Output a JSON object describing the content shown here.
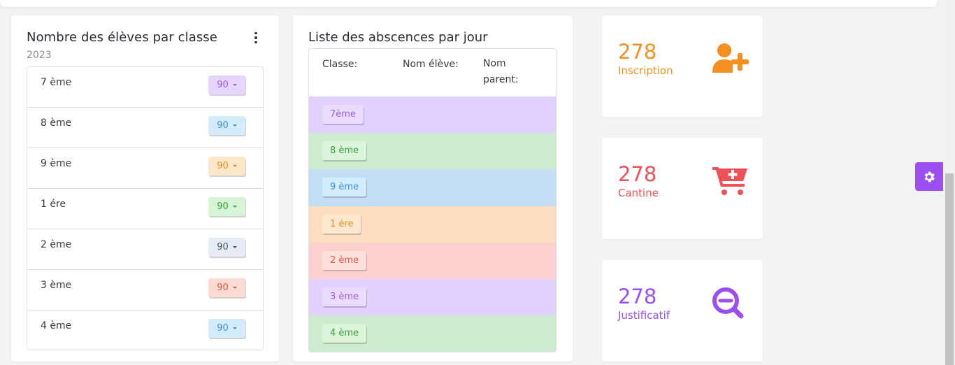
{
  "classes_card": {
    "title": "Nombre des élèves par classe",
    "year": "2023",
    "rows": [
      {
        "label": "7 ème",
        "count": "90",
        "bg": "#e6d6ff",
        "fg": "#9b5de5"
      },
      {
        "label": "8 ème",
        "count": "90",
        "bg": "#d2ecfb",
        "fg": "#3b8fd9"
      },
      {
        "label": "9 ème",
        "count": "90",
        "bg": "#fde7c9",
        "fg": "#e8891a"
      },
      {
        "label": "1 ére",
        "count": "90",
        "bg": "#d6f5d6",
        "fg": "#3aa13a"
      },
      {
        "label": "2 ème",
        "count": "90",
        "bg": "#e6ebf5",
        "fg": "#4a5670"
      },
      {
        "label": "3 ème",
        "count": "90",
        "bg": "#fddbd3",
        "fg": "#e05a46"
      },
      {
        "label": "4 ème",
        "count": "90",
        "bg": "#d2ecfb",
        "fg": "#3b8fd9"
      }
    ]
  },
  "absences_card": {
    "title": "Liste des abscences par jour",
    "headers": {
      "classe": "Classe:",
      "nom_eleve": "Nom élève:",
      "nom_parent": "Nom parent:"
    },
    "rows": [
      {
        "tag": "7ème",
        "row_bg": "#e1d1ff",
        "tag_bg": "#eadcff",
        "tag_fg": "#9b5de5"
      },
      {
        "tag": "8 ème",
        "row_bg": "#ccebcf",
        "tag_bg": "#dcf3dc",
        "tag_fg": "#3aa13a"
      },
      {
        "tag": "9 ème",
        "row_bg": "#c4def5",
        "tag_bg": "#d2ecfb",
        "tag_fg": "#3b8fd9"
      },
      {
        "tag": "1 ére",
        "row_bg": "#fddcbf",
        "tag_bg": "#fde9cf",
        "tag_fg": "#e8891a"
      },
      {
        "tag": "2 ème",
        "row_bg": "#fcd0cf",
        "tag_bg": "#fde0db",
        "tag_fg": "#e05a46"
      },
      {
        "tag": "3 ème",
        "row_bg": "#e1d1ff",
        "tag_bg": "#eadcff",
        "tag_fg": "#9b5de5"
      },
      {
        "tag": "4 ème",
        "row_bg": "#ccebcf",
        "tag_bg": "#dcf3dc",
        "tag_fg": "#3aa13a"
      }
    ]
  },
  "stats": [
    {
      "value": "278",
      "label": "Inscription",
      "color": "#f39021",
      "icon": "user-plus-icon"
    },
    {
      "value": "278",
      "label": "Cantine",
      "color": "#f05156",
      "icon": "cart-plus-icon"
    },
    {
      "value": "278",
      "label": "Justificatif",
      "color": "#9b4ff0",
      "icon": "search-minus-icon"
    }
  ],
  "settings": {
    "color": "#9b4ff0",
    "icon": "gear-icon"
  }
}
